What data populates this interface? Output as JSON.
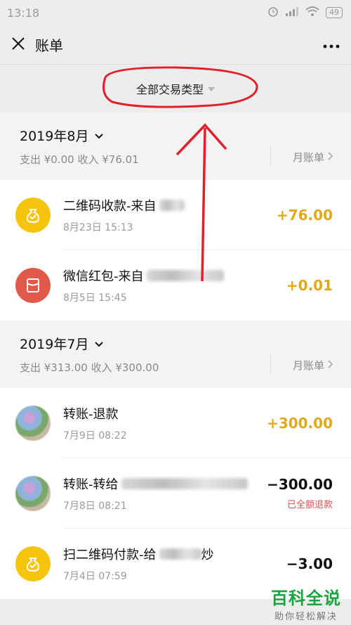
{
  "status_bar": {
    "time": "13:18",
    "battery": "49"
  },
  "nav": {
    "title": "账单"
  },
  "filter": {
    "label": "全部交易类型"
  },
  "months": [
    {
      "title": "2019年8月",
      "summary": "支出 ¥0.00 收入 ¥76.01",
      "bill_link": "月账单",
      "items": [
        {
          "title": "二维码收款-来自",
          "time": "8月23日 15:13",
          "amount": "+76.00",
          "refund": ""
        },
        {
          "title": "微信红包-来自",
          "time": "8月5日 15:45",
          "amount": "+0.01",
          "refund": ""
        }
      ]
    },
    {
      "title": "2019年7月",
      "summary": "支出 ¥313.00 收入 ¥300.00",
      "bill_link": "月账单",
      "items": [
        {
          "title": "转账-退款",
          "time": "7月9日 08:22",
          "amount": "+300.00",
          "refund": ""
        },
        {
          "title": "转账-转给",
          "time": "7月8日 08:21",
          "amount": "−300.00",
          "refund": "已全额退款"
        },
        {
          "title": "扫二维码付款-给",
          "title_suffix": "炒",
          "time": "7月4日 07:59",
          "amount": "−3.00",
          "refund": ""
        }
      ]
    }
  ],
  "watermark": {
    "main": "百科全说",
    "sub": "助你轻松解决"
  },
  "colors": {
    "income": "#e0a91c",
    "refund": "#d9534f",
    "annotation": "#e0202a"
  }
}
